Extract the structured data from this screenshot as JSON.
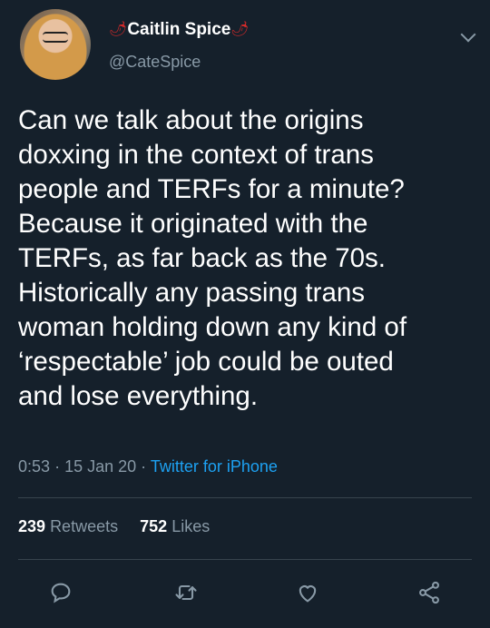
{
  "user": {
    "name": "Caitlin Spice",
    "handle": "@CateSpice"
  },
  "tweet": {
    "text": "Can we talk about the origins\ndoxxing in the context of trans\npeople and TERFs for a minute?\nBecause it originated with the\nTERFs, as far back as the 70s.\nHistorically any passing trans\nwoman holding down any kind of\n‘respectable’ job could be outed\nand lose everything.",
    "time": "0:53",
    "date": "15 Jan 20",
    "source": "Twitter for iPhone"
  },
  "stats": {
    "retweets_count": "239",
    "retweets_label": "Retweets",
    "likes_count": "752",
    "likes_label": "Likes"
  },
  "colors": {
    "background": "#15202b",
    "text": "#ffffff",
    "secondary": "#8899a6",
    "link": "#1da1f2",
    "divider": "#38444d"
  },
  "icons": {
    "avatar": "profile-photo",
    "name_decoration": "chili-pepper-icon",
    "menu": "chevron-down-icon",
    "reply": "reply-icon",
    "retweet": "retweet-icon",
    "like": "heart-icon",
    "share": "share-icon"
  }
}
